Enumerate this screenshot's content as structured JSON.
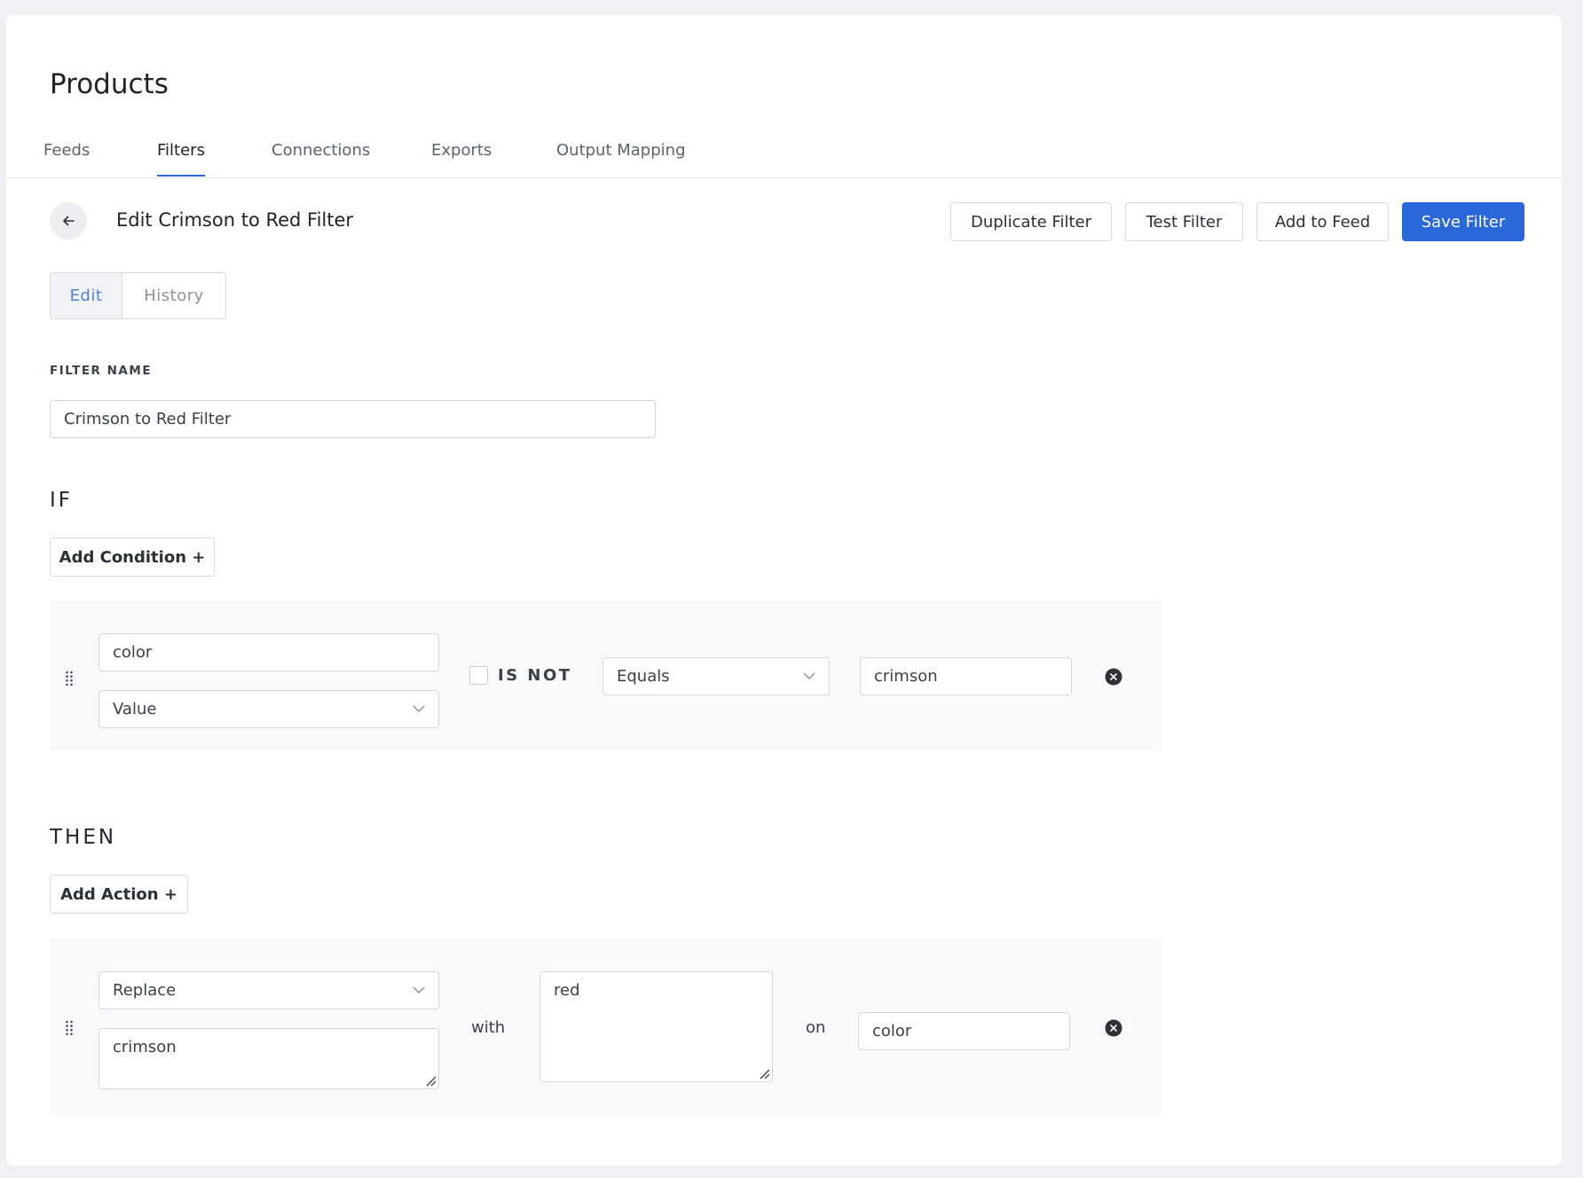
{
  "page": {
    "title": "Products"
  },
  "tabs": [
    {
      "label": "Feeds"
    },
    {
      "label": "Filters"
    },
    {
      "label": "Connections"
    },
    {
      "label": "Exports"
    },
    {
      "label": "Output Mapping"
    }
  ],
  "filter_header": {
    "title": "Edit Crimson to Red Filter",
    "buttons": {
      "duplicate": "Duplicate Filter",
      "test": "Test Filter",
      "add_to_feed": "Add to Feed",
      "save": "Save Filter"
    }
  },
  "view_toggle": {
    "edit": "Edit",
    "history": "History"
  },
  "filter_name": {
    "label": "FILTER NAME",
    "value": "Crimson to Red Filter"
  },
  "if_section": {
    "heading": "IF",
    "add_button": "Add Condition +",
    "condition": {
      "field": "color",
      "field_type": "Value",
      "negate_label": "IS NOT",
      "negate_checked": false,
      "operator": "Equals",
      "value": "crimson"
    }
  },
  "then_section": {
    "heading": "THEN",
    "add_button": "Add Action +",
    "action": {
      "type": "Replace",
      "find": "crimson",
      "with_label": "with",
      "replacement": "red",
      "on_label": "on",
      "target_field": "color"
    }
  },
  "colors": {
    "accent": "#2a68d9",
    "background": "#eff1f5",
    "rule_box": "#f8f9fb"
  }
}
